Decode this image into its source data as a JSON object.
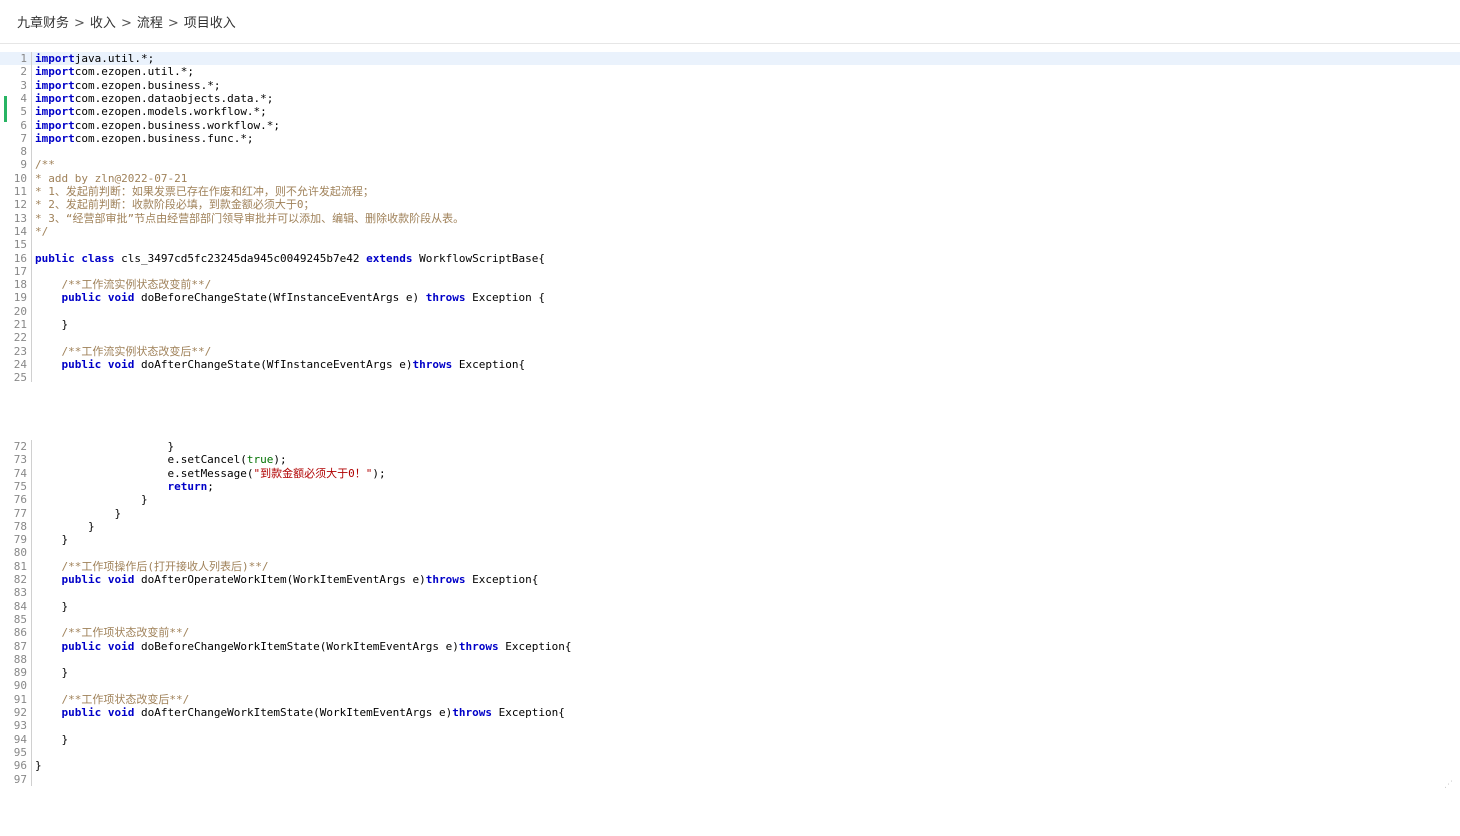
{
  "breadcrumb": {
    "items": [
      "九章财务",
      "收入",
      "流程"
    ],
    "current": "项目收入",
    "separator": ">"
  },
  "editor": {
    "top_lines": [
      {
        "n": "1",
        "parts": [
          [
            "kw",
            "import"
          ],
          [
            "",
            "java.util.*;"
          ]
        ]
      },
      {
        "n": "2",
        "parts": [
          [
            "kw",
            "import"
          ],
          [
            "",
            "com.ezopen.util.*;"
          ]
        ]
      },
      {
        "n": "3",
        "parts": [
          [
            "kw",
            "import"
          ],
          [
            "",
            "com.ezopen.business.*;"
          ]
        ]
      },
      {
        "n": "4",
        "parts": [
          [
            "kw",
            "import"
          ],
          [
            "",
            "com.ezopen.dataobjects.data.*;"
          ]
        ]
      },
      {
        "n": "5",
        "parts": [
          [
            "kw",
            "import"
          ],
          [
            "",
            "com.ezopen.models.workflow.*;"
          ]
        ]
      },
      {
        "n": "6",
        "parts": [
          [
            "kw",
            "import"
          ],
          [
            "",
            "com.ezopen.business.workflow.*;"
          ]
        ]
      },
      {
        "n": "7",
        "parts": [
          [
            "kw",
            "import"
          ],
          [
            "",
            "com.ezopen.business.func.*;"
          ]
        ]
      },
      {
        "n": "8",
        "parts": []
      },
      {
        "n": "9",
        "parts": [
          [
            "cm",
            "/**"
          ]
        ]
      },
      {
        "n": "10",
        "parts": [
          [
            "cm",
            "* add by zln@2022-07-21"
          ]
        ]
      },
      {
        "n": "11",
        "parts": [
          [
            "cm",
            "* 1、发起前判断：如果发票已存在作废和红冲，则不允许发起流程；"
          ]
        ]
      },
      {
        "n": "12",
        "parts": [
          [
            "cm",
            "* 2、发起前判断：收款阶段必填，到款金额必须大于0；"
          ]
        ]
      },
      {
        "n": "13",
        "parts": [
          [
            "cm",
            "* 3、“经营部审批”节点由经营部部门领导审批并可以添加、编辑、删除收款阶段从表。"
          ]
        ]
      },
      {
        "n": "14",
        "parts": [
          [
            "cm",
            "*/"
          ]
        ]
      },
      {
        "n": "15",
        "parts": []
      },
      {
        "n": "16",
        "parts": [
          [
            "kw",
            "public class"
          ],
          [
            "",
            " cls_3497cd5fc23245da945c0049245b7e42 "
          ],
          [
            "kw",
            "extends"
          ],
          [
            "",
            " WorkflowScriptBase{"
          ]
        ]
      },
      {
        "n": "17",
        "parts": []
      },
      {
        "n": "18",
        "parts": [
          [
            "",
            "    "
          ],
          [
            "cm",
            "/**工作流实例状态改变前**/"
          ]
        ]
      },
      {
        "n": "19",
        "parts": [
          [
            "",
            "    "
          ],
          [
            "kw",
            "public void"
          ],
          [
            "",
            " doBeforeChangeState(WfInstanceEventArgs e) "
          ],
          [
            "kw",
            "throws"
          ],
          [
            "",
            " Exception {"
          ]
        ]
      },
      {
        "n": "20",
        "parts": []
      },
      {
        "n": "21",
        "parts": [
          [
            "",
            "    }"
          ]
        ]
      },
      {
        "n": "22",
        "parts": []
      },
      {
        "n": "23",
        "parts": [
          [
            "",
            "    "
          ],
          [
            "cm",
            "/**工作流实例状态改变后**/"
          ]
        ]
      },
      {
        "n": "24",
        "parts": [
          [
            "",
            "    "
          ],
          [
            "kw",
            "public void"
          ],
          [
            "",
            " doAfterChangeState(WfInstanceEventArgs e)"
          ],
          [
            "kw",
            "throws"
          ],
          [
            "",
            " Exception{"
          ]
        ]
      },
      {
        "n": "25",
        "parts": []
      }
    ],
    "bottom_lines": [
      {
        "n": "72",
        "parts": [
          [
            "",
            "                    }"
          ]
        ]
      },
      {
        "n": "73",
        "parts": [
          [
            "",
            "                    e.setCancel("
          ],
          [
            "lit",
            "true"
          ],
          [
            "",
            ");"
          ]
        ]
      },
      {
        "n": "74",
        "parts": [
          [
            "",
            "                    e.setMessage("
          ],
          [
            "str",
            "\"到款金额必须大于0！\""
          ],
          [
            "",
            ");"
          ]
        ]
      },
      {
        "n": "75",
        "parts": [
          [
            "",
            "                    "
          ],
          [
            "kw",
            "return"
          ],
          [
            "",
            ";"
          ]
        ]
      },
      {
        "n": "76",
        "parts": [
          [
            "",
            "                }"
          ]
        ]
      },
      {
        "n": "77",
        "parts": [
          [
            "",
            "            }"
          ]
        ]
      },
      {
        "n": "78",
        "parts": [
          [
            "",
            "        }"
          ]
        ]
      },
      {
        "n": "79",
        "parts": [
          [
            "",
            "    }"
          ]
        ]
      },
      {
        "n": "80",
        "parts": []
      },
      {
        "n": "81",
        "parts": [
          [
            "",
            "    "
          ],
          [
            "cm",
            "/**工作项操作后(打开接收人列表后)**/"
          ]
        ]
      },
      {
        "n": "82",
        "parts": [
          [
            "",
            "    "
          ],
          [
            "kw",
            "public void"
          ],
          [
            "",
            " doAfterOperateWorkItem(WorkItemEventArgs e)"
          ],
          [
            "kw",
            "throws"
          ],
          [
            "",
            " Exception{"
          ]
        ]
      },
      {
        "n": "83",
        "parts": []
      },
      {
        "n": "84",
        "parts": [
          [
            "",
            "    }"
          ]
        ]
      },
      {
        "n": "85",
        "parts": []
      },
      {
        "n": "86",
        "parts": [
          [
            "",
            "    "
          ],
          [
            "cm",
            "/**工作项状态改变前**/"
          ]
        ]
      },
      {
        "n": "87",
        "parts": [
          [
            "",
            "    "
          ],
          [
            "kw",
            "public void"
          ],
          [
            "",
            " doBeforeChangeWorkItemState(WorkItemEventArgs e)"
          ],
          [
            "kw",
            "throws"
          ],
          [
            "",
            " Exception{"
          ]
        ]
      },
      {
        "n": "88",
        "parts": []
      },
      {
        "n": "89",
        "parts": [
          [
            "",
            "    }"
          ]
        ]
      },
      {
        "n": "90",
        "parts": []
      },
      {
        "n": "91",
        "parts": [
          [
            "",
            "    "
          ],
          [
            "cm",
            "/**工作项状态改变后**/"
          ]
        ]
      },
      {
        "n": "92",
        "parts": [
          [
            "",
            "    "
          ],
          [
            "kw",
            "public void"
          ],
          [
            "",
            " doAfterChangeWorkItemState(WorkItemEventArgs e)"
          ],
          [
            "kw",
            "throws"
          ],
          [
            "",
            " Exception{"
          ]
        ]
      },
      {
        "n": "93",
        "parts": []
      },
      {
        "n": "94",
        "parts": [
          [
            "",
            "    }"
          ]
        ]
      },
      {
        "n": "95",
        "parts": []
      },
      {
        "n": "96",
        "parts": [
          [
            "",
            "}"
          ]
        ]
      },
      {
        "n": "97",
        "parts": []
      }
    ]
  }
}
